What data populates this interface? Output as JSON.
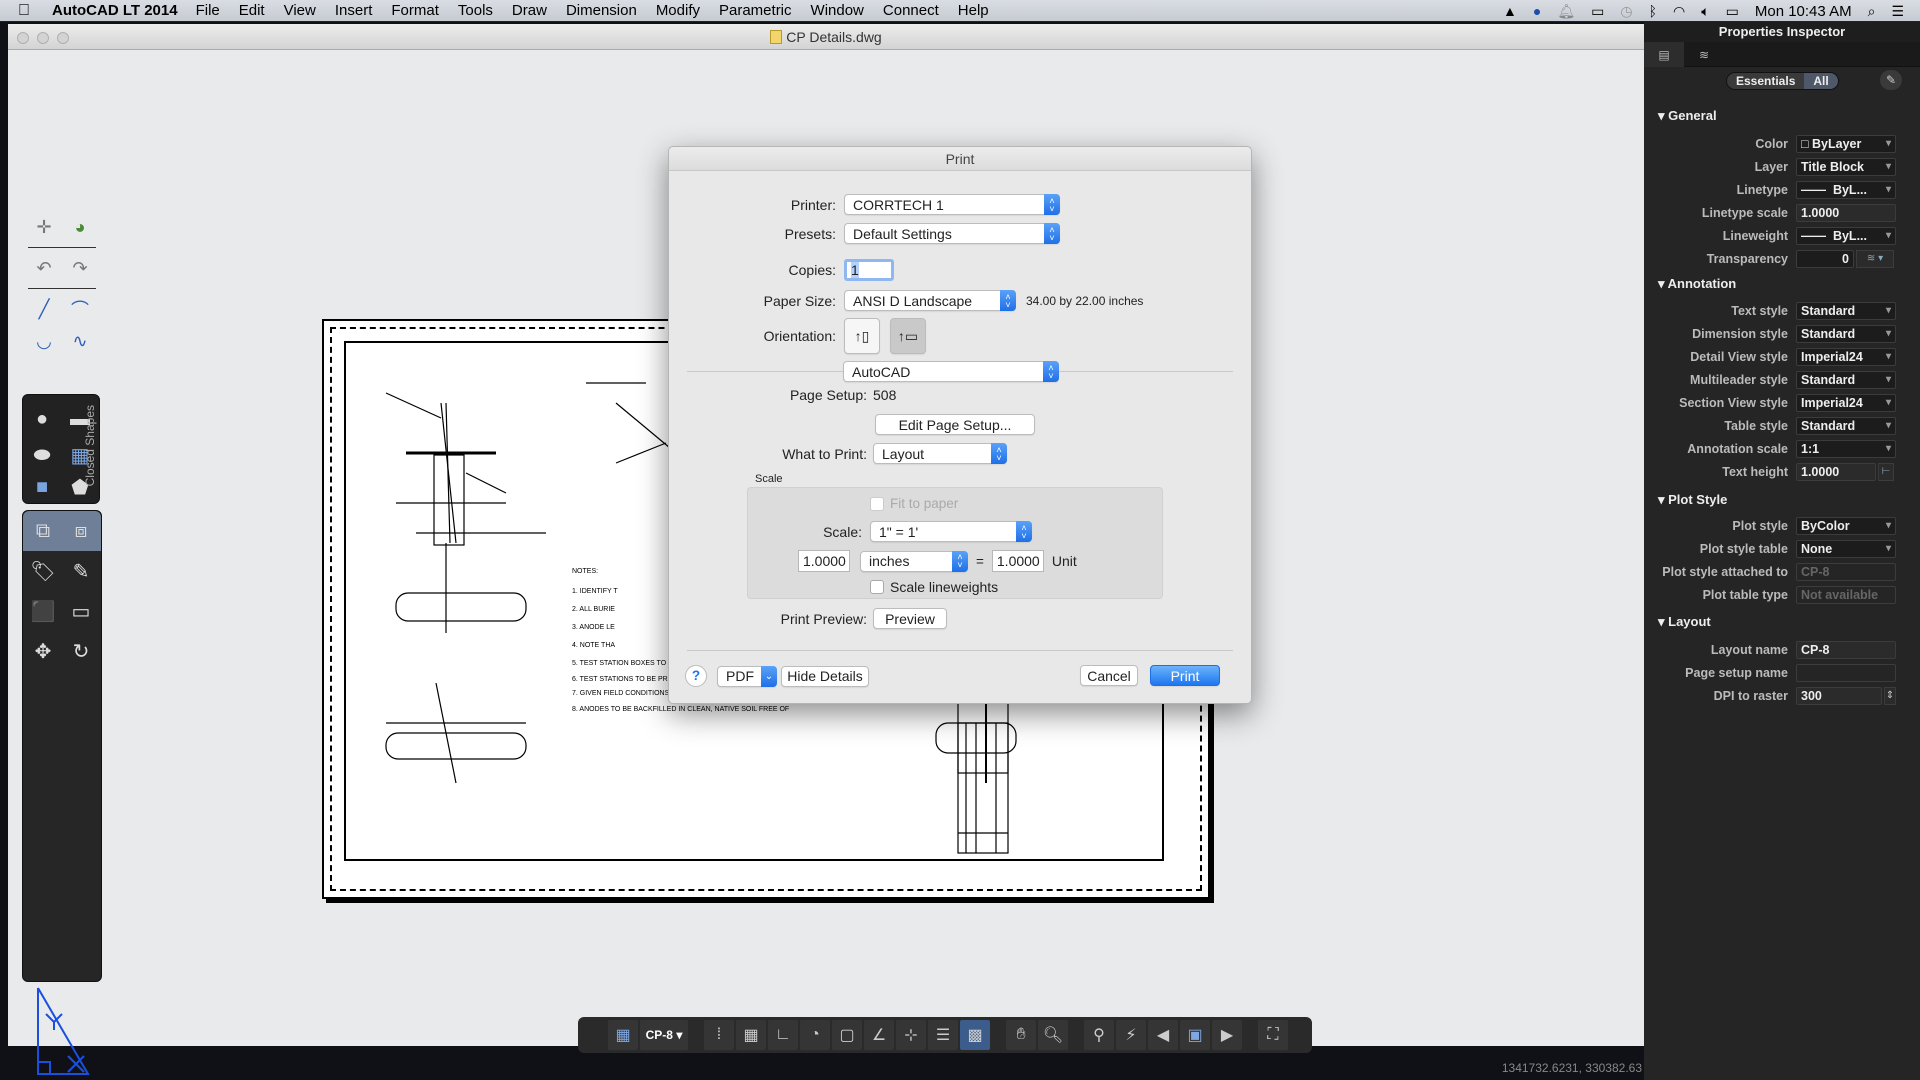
{
  "menubar": {
    "app_name": "AutoCAD LT 2014",
    "menus": [
      "File",
      "Edit",
      "View",
      "Insert",
      "Format",
      "Tools",
      "Draw",
      "Dimension",
      "Modify",
      "Parametric",
      "Window",
      "Connect",
      "Help"
    ],
    "clock": "Mon 10:43 AM"
  },
  "window": {
    "title": "CP Details.dwg"
  },
  "left_toolbar": {
    "closed_shapes_label": "Closed Shapes"
  },
  "print_dialog": {
    "title": "Print",
    "printer_label": "Printer:",
    "printer_value": "CORRTECH 1",
    "presets_label": "Presets:",
    "presets_value": "Default Settings",
    "copies_label": "Copies:",
    "copies_value": "1",
    "paper_size_label": "Paper Size:",
    "paper_size_value": "ANSI D Landscape",
    "paper_size_dims": "34.00 by 22.00 inches",
    "orientation_label": "Orientation:",
    "panel_value": "AutoCAD",
    "page_setup_label": "Page Setup:",
    "page_setup_value": "508",
    "edit_page_setup_button": "Edit Page Setup...",
    "what_to_print_label": "What to Print:",
    "what_to_print_value": "Layout",
    "scale_group_label": "Scale",
    "fit_to_paper_label": "Fit to paper",
    "scale_label": "Scale:",
    "scale_value": "1\" = 1'",
    "scale_left_value": "1.0000",
    "scale_units_value": "inches",
    "scale_equals": "=",
    "scale_right_value": "1.0000",
    "scale_unit_label": "Unit",
    "scale_lineweights_label": "Scale lineweights",
    "print_preview_label": "Print Preview:",
    "preview_button": "Preview",
    "help_button": "?",
    "pdf_button": "PDF",
    "hide_details_button": "Hide Details",
    "cancel_button": "Cancel",
    "print_button": "Print"
  },
  "status_bar": {
    "layout_name": "CP-8",
    "coordinates": "1341732.6231, 330382.63"
  },
  "properties_inspector": {
    "title": "Properties Inspector",
    "seg_essentials": "Essentials",
    "seg_all": "All",
    "sections": {
      "general": "General",
      "annotation": "Annotation",
      "plot_style": "Plot Style",
      "layout": "Layout"
    },
    "general": [
      {
        "label": "Color",
        "value": "ByLayer"
      },
      {
        "label": "Layer",
        "value": "Title Block"
      },
      {
        "label": "Linetype",
        "value": "ByL..."
      },
      {
        "label": "Linetype scale",
        "value": "1.0000"
      },
      {
        "label": "Lineweight",
        "value": "ByL..."
      },
      {
        "label": "Transparency",
        "value": "0"
      }
    ],
    "annotation": [
      {
        "label": "Text style",
        "value": "Standard"
      },
      {
        "label": "Dimension style",
        "value": "Standard"
      },
      {
        "label": "Detail View style",
        "value": "Imperial24"
      },
      {
        "label": "Multileader style",
        "value": "Standard"
      },
      {
        "label": "Section View style",
        "value": "Imperial24"
      },
      {
        "label": "Table style",
        "value": "Standard"
      },
      {
        "label": "Annotation scale",
        "value": "1:1"
      },
      {
        "label": "Text height",
        "value": "1.0000"
      }
    ],
    "plot_style": [
      {
        "label": "Plot style",
        "value": "ByColor"
      },
      {
        "label": "Plot style table",
        "value": "None"
      },
      {
        "label": "Plot style attached to",
        "value": "CP-8"
      },
      {
        "label": "Plot table type",
        "value": "Not available"
      }
    ],
    "layout": [
      {
        "label": "Layout name",
        "value": "CP-8"
      },
      {
        "label": "Page setup name",
        "value": ""
      },
      {
        "label": "DPI to raster",
        "value": "300"
      }
    ]
  }
}
